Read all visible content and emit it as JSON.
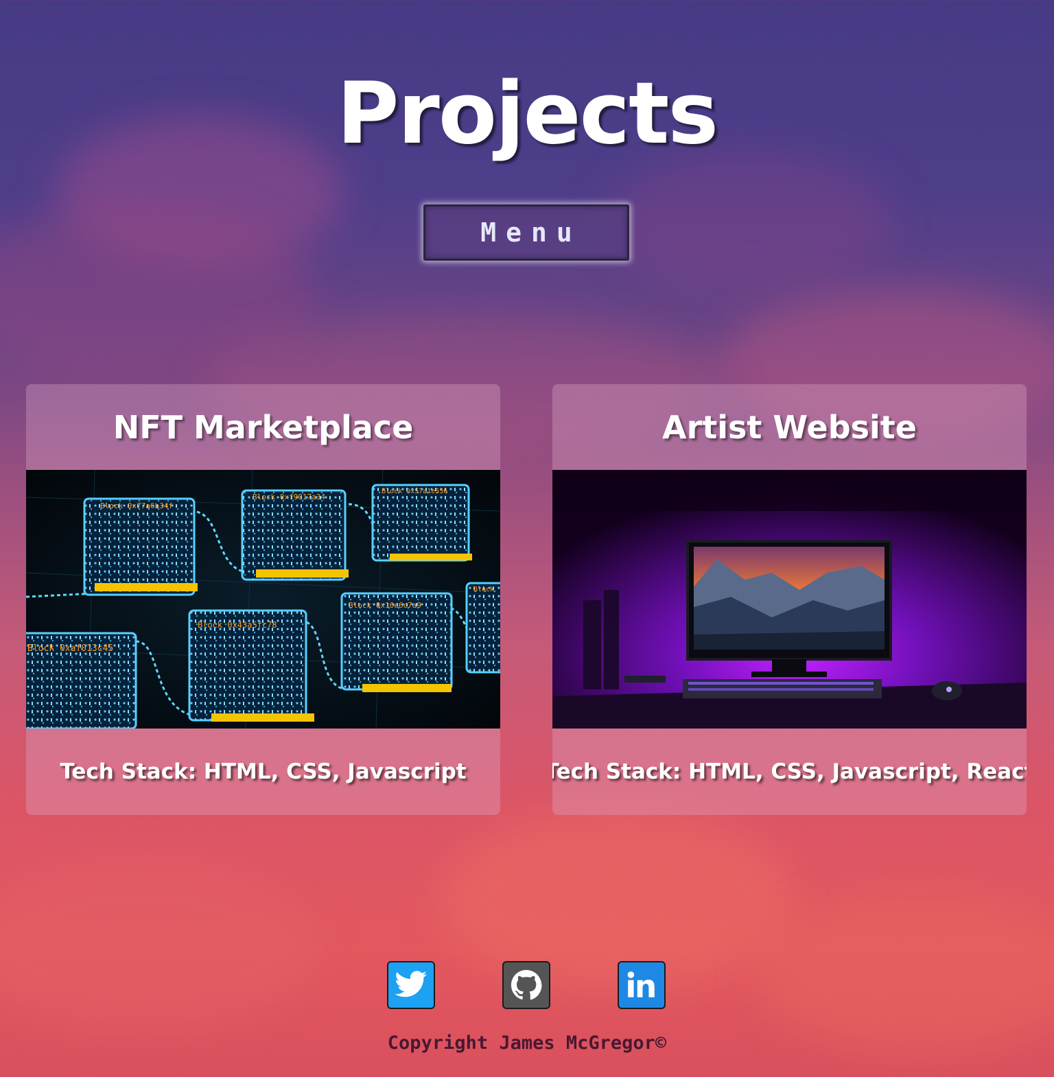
{
  "page": {
    "title": "Projects"
  },
  "menu": {
    "label": "Menu"
  },
  "projects": [
    {
      "title": "NFT Marketplace",
      "tech_stack": "Tech Stack: HTML, CSS, Javascript",
      "image": "blockchain-blocks-image",
      "block_labels": [
        "Block 0x77a6b34f",
        "Block 0xf9017a34",
        "Block 0x57a1e556",
        "Block 0xaf013c45",
        "Block 0x43a5fc78",
        "Block 0x10e6c7a9",
        "Block"
      ]
    },
    {
      "title": "Artist Website",
      "tech_stack": "Tech Stack: HTML, CSS, Javascript, React",
      "image": "purple-lit-desk-computer-image"
    }
  ],
  "socials": [
    {
      "name": "twitter",
      "icon": "twitter-icon",
      "color": "#1da1f2"
    },
    {
      "name": "github",
      "icon": "github-icon",
      "color": "#555555"
    },
    {
      "name": "linkedin",
      "icon": "linkedin-icon",
      "color": "#1e88e5"
    }
  ],
  "footer": {
    "copyright": "Copyright James McGregor©"
  }
}
